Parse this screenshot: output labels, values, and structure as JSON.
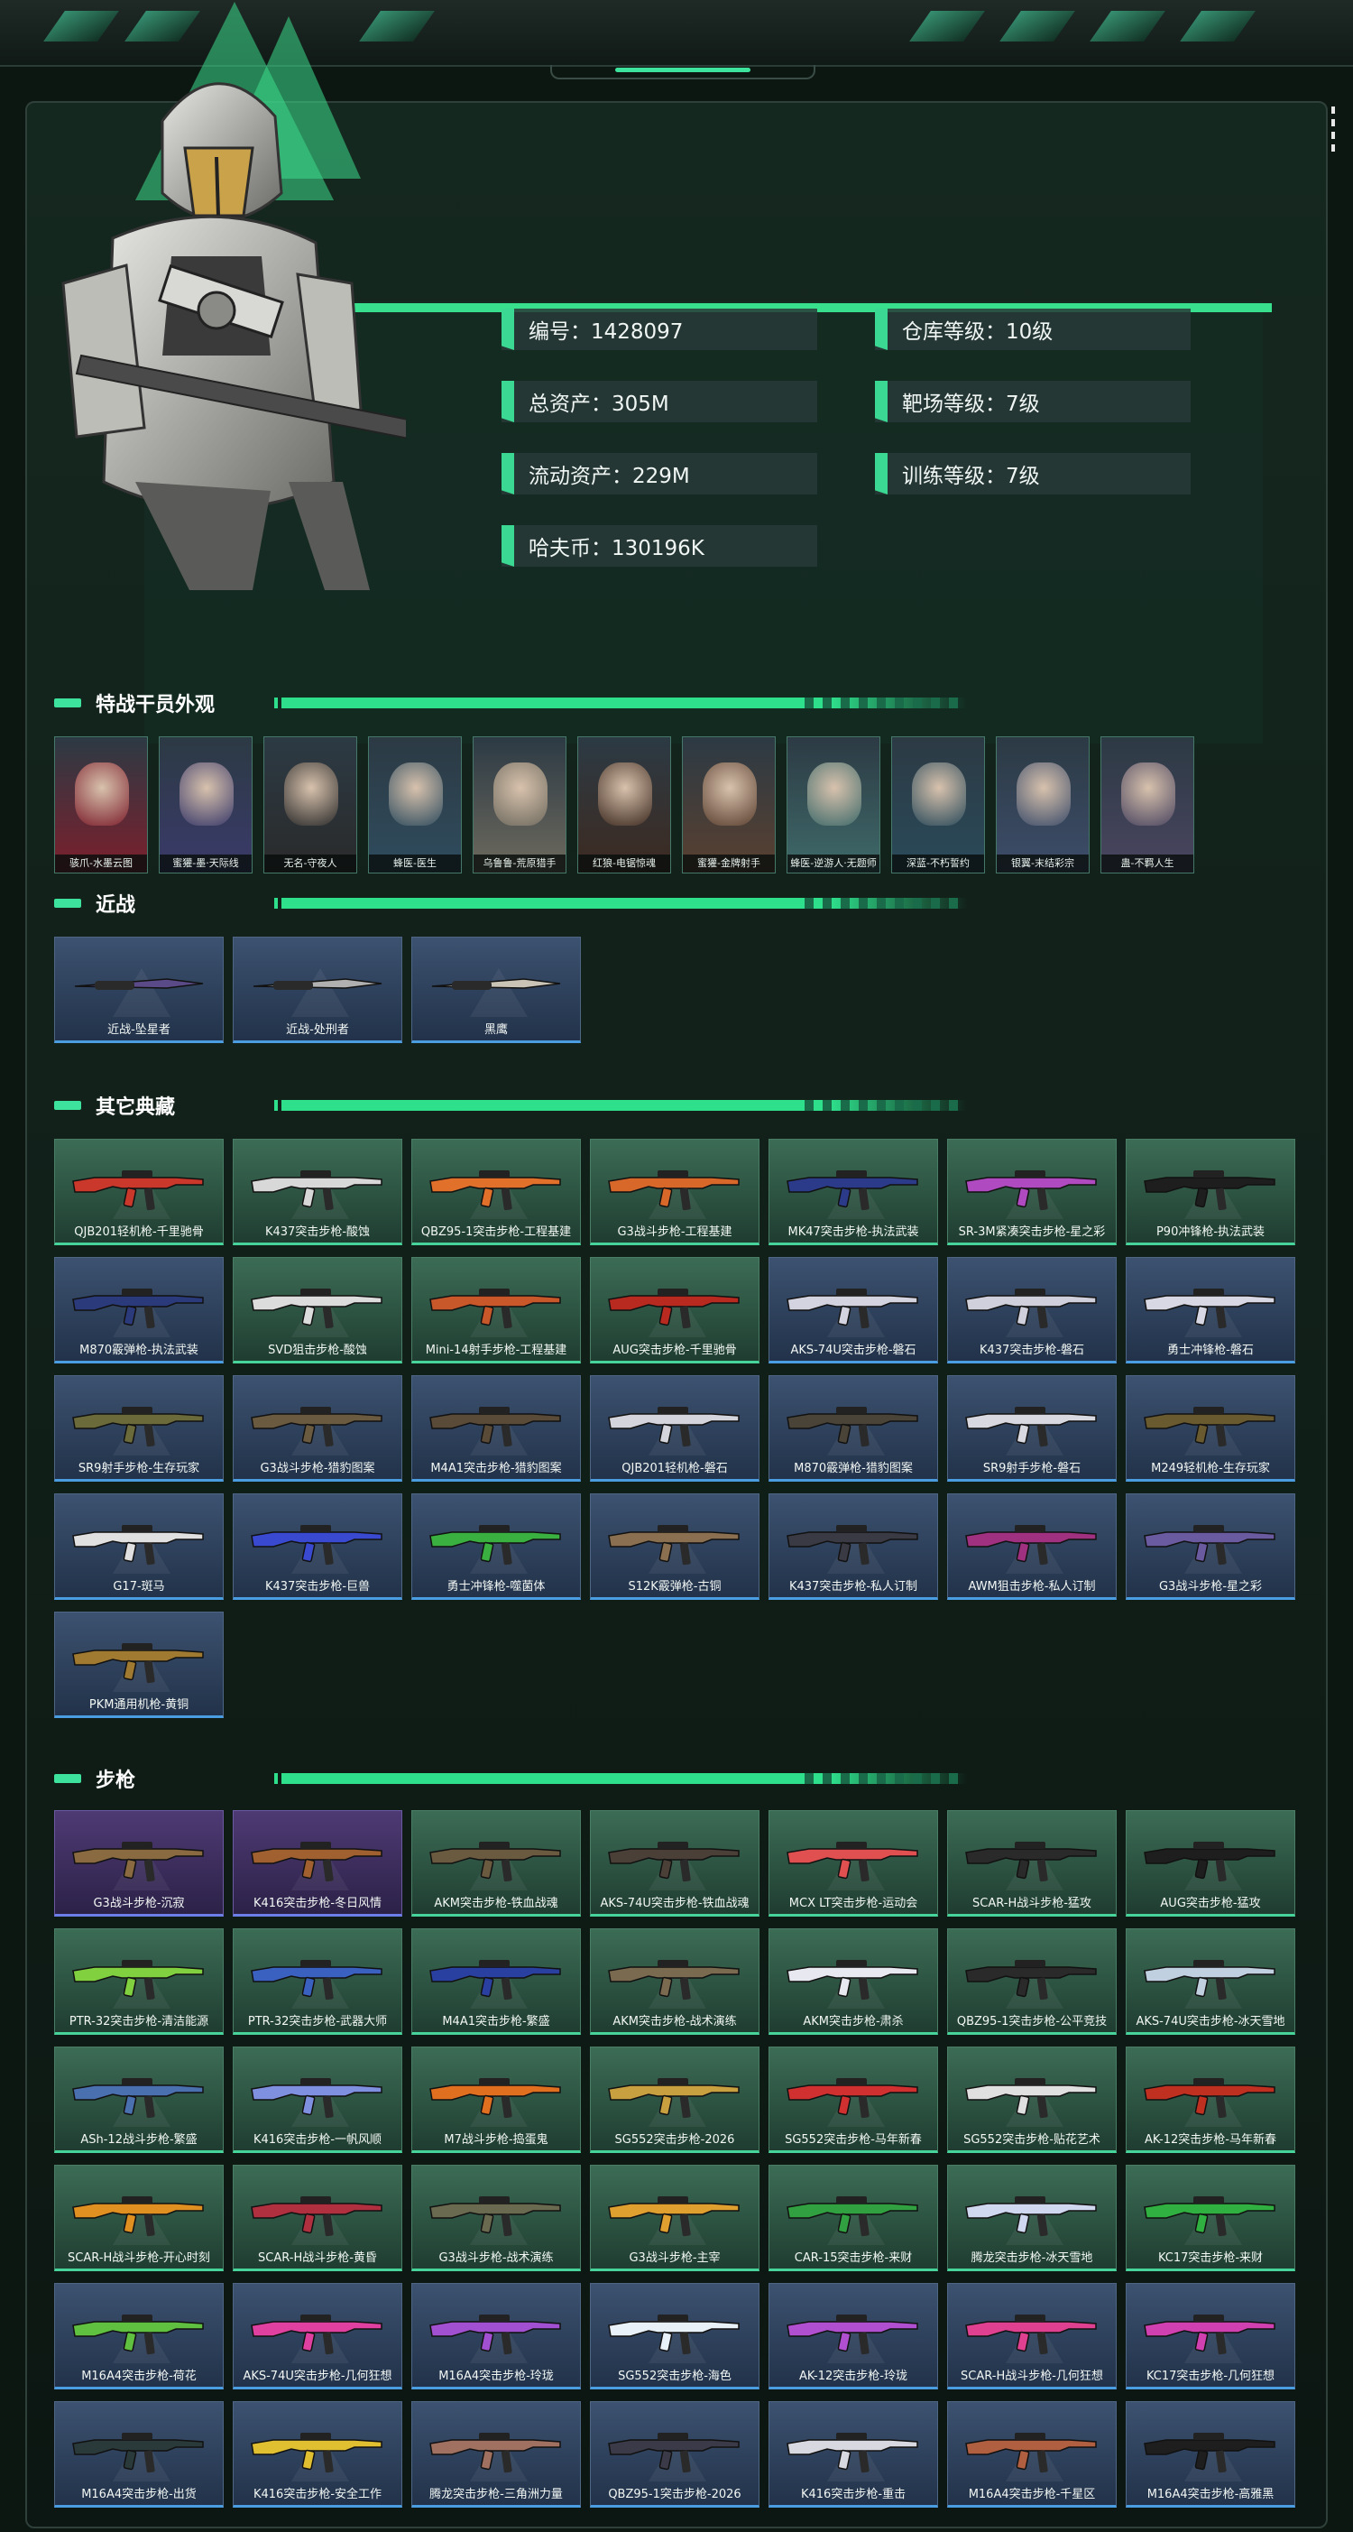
{
  "profile": {
    "stats": [
      {
        "label": "编号：1428097"
      },
      {
        "label": "仓库等级：10级"
      },
      {
        "label": "总资产：305M"
      },
      {
        "label": "靶场等级：7级"
      },
      {
        "label": "流动资产：229M"
      },
      {
        "label": "训练等级：7级"
      },
      {
        "label": "哈夫币：130196K"
      }
    ]
  },
  "sections": {
    "operators": {
      "title": "特战干员外观"
    },
    "melee": {
      "title": "近战"
    },
    "collection": {
      "title": "其它典藏"
    },
    "rifles": {
      "title": "步枪"
    }
  },
  "operators": [
    {
      "label": "骇爪-水墨云图",
      "color": "#7c1f2c"
    },
    {
      "label": "蜜獾-墨·天际线",
      "color": "#3a3a6a"
    },
    {
      "label": "无名-守夜人",
      "color": "#2a2a2a"
    },
    {
      "label": "蜂医-医生",
      "color": "#2f4c5e"
    },
    {
      "label": "乌鲁鲁-荒原猎手",
      "color": "#6e6a5e"
    },
    {
      "label": "红狼-电锯惊魂",
      "color": "#3d2a20"
    },
    {
      "label": "蜜獾-金牌射手",
      "color": "#5a4030"
    },
    {
      "label": "蜂医-逆游人·无题师",
      "color": "#3f6a6a"
    },
    {
      "label": "深蓝-不朽誓约",
      "color": "#2a4a5a"
    },
    {
      "label": "银翼-末结彩宗",
      "color": "#3d4d6a"
    },
    {
      "label": "蛊-不羁人生",
      "color": "#4a4560"
    }
  ],
  "melee": [
    {
      "label": "近战-坠星者",
      "color": "#5a4a88"
    },
    {
      "label": "近战-处刑者",
      "color": "#b0b0b0"
    },
    {
      "label": "黑鹰",
      "color": "#c9c4b5"
    }
  ],
  "collection": [
    {
      "label": "QJB201轻机枪-千里驰骨",
      "theme": "g",
      "color": "#c9382a"
    },
    {
      "label": "K437突击步枪-酸蚀",
      "theme": "g",
      "color": "#d8d8d8"
    },
    {
      "label": "QBZ95-1突击步枪-工程基建",
      "theme": "g",
      "color": "#e0702a"
    },
    {
      "label": "G3战斗步枪-工程基建",
      "theme": "g",
      "color": "#d8682a"
    },
    {
      "label": "MK47突击步枪-执法武装",
      "theme": "g",
      "color": "#2b3b8a"
    },
    {
      "label": "SR-3M紧凑突击步枪-星之彩",
      "theme": "g",
      "color": "#b04ac0"
    },
    {
      "label": "P90冲锋枪-执法武装",
      "theme": "g",
      "color": "#1e1e1e"
    },
    {
      "label": "M870霰弹枪-执法武装",
      "theme": "b",
      "color": "#2a3a7a"
    },
    {
      "label": "SVD狙击步枪-酸蚀",
      "theme": "g",
      "color": "#dcdcdc"
    },
    {
      "label": "Mini-14射手步枪-工程基建",
      "theme": "g",
      "color": "#c8582a"
    },
    {
      "label": "AUG突击步枪-千里驰骨",
      "theme": "g",
      "color": "#b82a20"
    },
    {
      "label": "AKS-74U突击步枪-磐石",
      "theme": "b",
      "color": "#d4d4e0"
    },
    {
      "label": "K437突击步枪-磐石",
      "theme": "b",
      "color": "#d0d0dc"
    },
    {
      "label": "勇士冲锋枪-磐石",
      "theme": "b",
      "color": "#d8d8e4"
    },
    {
      "label": "SR9射手步枪-生存玩家",
      "theme": "b",
      "color": "#6a6a3a"
    },
    {
      "label": "G3战斗步枪-猎豹图案",
      "theme": "b",
      "color": "#6a5a40"
    },
    {
      "label": "M4A1突击步枪-猎豹图案",
      "theme": "b",
      "color": "#5a4a38"
    },
    {
      "label": "QJB201轻机枪-磐石",
      "theme": "b",
      "color": "#d4d4dc"
    },
    {
      "label": "M870霰弹枪-猎豹图案",
      "theme": "b",
      "color": "#4a4438"
    },
    {
      "label": "SR9射手步枪-磐石",
      "theme": "b",
      "color": "#d8d8e0"
    },
    {
      "label": "M249轻机枪-生存玩家",
      "theme": "b",
      "color": "#6a5a30"
    },
    {
      "label": "G17-斑马",
      "theme": "b",
      "color": "#e0e0e0"
    },
    {
      "label": "K437突击步枪-巨兽",
      "theme": "b",
      "color": "#3a4ad0"
    },
    {
      "label": "勇士冲锋枪-噬菌体",
      "theme": "b",
      "color": "#3ab040"
    },
    {
      "label": "S12K霰弹枪-古铜",
      "theme": "b",
      "color": "#8a7050"
    },
    {
      "label": "K437突击步枪-私人订制",
      "theme": "b",
      "color": "#3a3a44"
    },
    {
      "label": "AWM狙击步枪-私人订制",
      "theme": "b",
      "color": "#a03080"
    },
    {
      "label": "G3战斗步枪-星之彩",
      "theme": "b",
      "color": "#6a5aa0"
    },
    {
      "label": "PKM通用机枪-黄铜",
      "theme": "b",
      "color": "#a07a30"
    }
  ],
  "rifles": [
    {
      "label": "G3战斗步枪-沉寂",
      "theme": "p",
      "color": "#8a6a40"
    },
    {
      "label": "K416突击步枪-冬日风情",
      "theme": "p",
      "color": "#a06030"
    },
    {
      "label": "AKM突击步枪-铁血战魂",
      "theme": "g",
      "color": "#6a5a40"
    },
    {
      "label": "AKS-74U突击步枪-铁血战魂",
      "theme": "g",
      "color": "#4a4038"
    },
    {
      "label": "MCX LT突击步枪-运动会",
      "theme": "g",
      "color": "#e05050"
    },
    {
      "label": "SCAR-H战斗步枪-猛攻",
      "theme": "g",
      "color": "#2a2a2a"
    },
    {
      "label": "AUG突击步枪-猛攻",
      "theme": "g",
      "color": "#1e1e1e"
    },
    {
      "label": "PTR-32突击步枪-清洁能源",
      "theme": "g",
      "color": "#80d040"
    },
    {
      "label": "PTR-32突击步枪-武器大师",
      "theme": "g",
      "color": "#3a60c0"
    },
    {
      "label": "M4A1突击步枪-繁盛",
      "theme": "g",
      "color": "#2a40a0"
    },
    {
      "label": "AKM突击步枪-战术演练",
      "theme": "g",
      "color": "#7a6a50"
    },
    {
      "label": "AKM突击步枪-肃杀",
      "theme": "g",
      "color": "#e8e8f0"
    },
    {
      "label": "QBZ95-1突击步枪-公平竞技",
      "theme": "g",
      "color": "#2a2a2a"
    },
    {
      "label": "AKS-74U突击步枪-冰天雪地",
      "theme": "g",
      "color": "#c0d0e0"
    },
    {
      "label": "ASh-12战斗步枪-繁盛",
      "theme": "g",
      "color": "#4a70b0"
    },
    {
      "label": "K416突击步枪-一帆风顺",
      "theme": "g",
      "color": "#8090e0"
    },
    {
      "label": "M7战斗步枪-捣蛋鬼",
      "theme": "g",
      "color": "#e07020"
    },
    {
      "label": "SG552突击步枪-2026",
      "theme": "g",
      "color": "#c8a040"
    },
    {
      "label": "SG552突击步枪-马年新春",
      "theme": "g",
      "color": "#d03030"
    },
    {
      "label": "SG552突击步枪-贴花艺术",
      "theme": "g",
      "color": "#e0e0e0"
    },
    {
      "label": "AK-12突击步枪-马年新春",
      "theme": "g",
      "color": "#c03020"
    },
    {
      "label": "SCAR-H战斗步枪-开心时刻",
      "theme": "g",
      "color": "#e09020"
    },
    {
      "label": "SCAR-H战斗步枪-黄昏",
      "theme": "g",
      "color": "#b03040"
    },
    {
      "label": "G3战斗步枪-战术演练",
      "theme": "g",
      "color": "#6a6a50"
    },
    {
      "label": "G3战斗步枪-主宰",
      "theme": "g",
      "color": "#e0a030"
    },
    {
      "label": "CAR-15突击步枪-来财",
      "theme": "g",
      "color": "#30a040"
    },
    {
      "label": "腾龙突击步枪-冰天雪地",
      "theme": "g",
      "color": "#d0d8f0"
    },
    {
      "label": "KC17突击步枪-来财",
      "theme": "g",
      "color": "#30b040"
    },
    {
      "label": "M16A4突击步枪-荷花",
      "theme": "b",
      "color": "#60c040"
    },
    {
      "label": "AKS-74U突击步枪-几何狂想",
      "theme": "b",
      "color": "#e040a0"
    },
    {
      "label": "M16A4突击步枪-玲珑",
      "theme": "b",
      "color": "#a050d0"
    },
    {
      "label": "SG552突击步枪-海色",
      "theme": "b",
      "color": "#e8f0f8"
    },
    {
      "label": "AK-12突击步枪-玲珑",
      "theme": "b",
      "color": "#b050d0"
    },
    {
      "label": "SCAR-H战斗步枪-几何狂想",
      "theme": "b",
      "color": "#e04090"
    },
    {
      "label": "KC17突击步枪-几何狂想",
      "theme": "b",
      "color": "#d040b0"
    },
    {
      "label": "M16A4突击步枪-出货",
      "theme": "b",
      "color": "#2a3a3a"
    },
    {
      "label": "K416突击步枪-安全工作",
      "theme": "b",
      "color": "#e0c030"
    },
    {
      "label": "腾龙突击步枪-三角洲力量",
      "theme": "b",
      "color": "#a07060"
    },
    {
      "label": "QBZ95-1突击步枪-2026",
      "theme": "b",
      "color": "#3a3a48"
    },
    {
      "label": "K416突击步枪-重击",
      "theme": "b",
      "color": "#d8d8e0"
    },
    {
      "label": "M16A4突击步枪-千星区",
      "theme": "b",
      "color": "#b06040"
    },
    {
      "label": "M16A4突击步枪-高雅黑",
      "theme": "b",
      "color": "#1e1e1e"
    }
  ]
}
